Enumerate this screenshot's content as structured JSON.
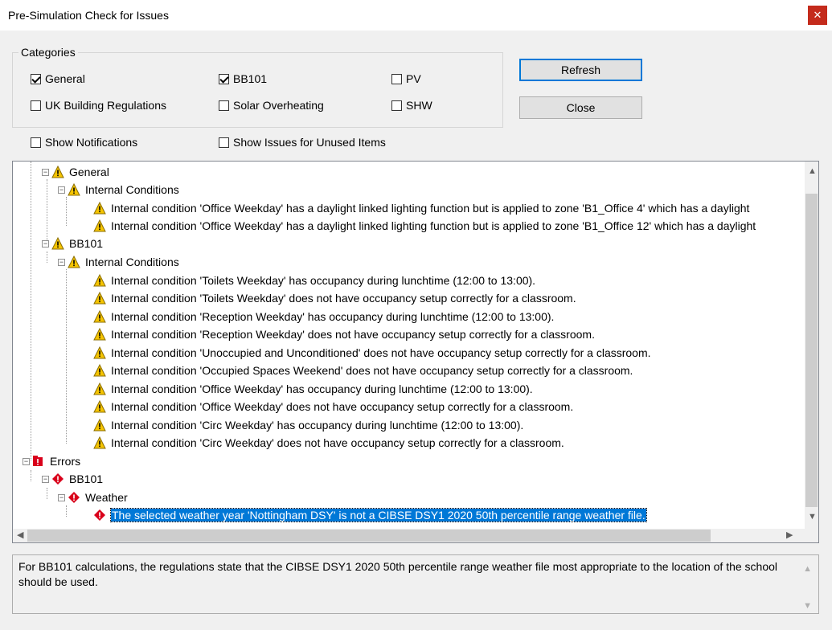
{
  "window": {
    "title": "Pre-Simulation Check for Issues",
    "close_glyph": "✕"
  },
  "categories": {
    "label": "Categories",
    "items": [
      {
        "label": "General",
        "checked": true
      },
      {
        "label": "BB101",
        "checked": true
      },
      {
        "label": "PV",
        "checked": false
      },
      {
        "label": "UK Building Regulations",
        "checked": false
      },
      {
        "label": "Solar Overheating",
        "checked": false
      },
      {
        "label": "SHW",
        "checked": false
      }
    ]
  },
  "options": {
    "show_notifications": {
      "label": "Show Notifications",
      "checked": false
    },
    "show_unused": {
      "label": "Show Issues for Unused Items",
      "checked": false
    }
  },
  "buttons": {
    "refresh": "Refresh",
    "close": "Close"
  },
  "tree": {
    "general": "General",
    "general_internal": "Internal Conditions",
    "general_items": [
      "Internal condition 'Office Weekday' has a daylight linked lighting function but is applied to zone 'B1_Office 4' which has a daylight",
      "Internal condition 'Office Weekday' has a daylight linked lighting function but is applied to zone 'B1_Office 12' which has a daylight"
    ],
    "bb101": "BB101",
    "bb101_internal": "Internal Conditions",
    "bb101_items": [
      "Internal condition 'Toilets Weekday' has occupancy during lunchtime (12:00 to 13:00).",
      "Internal condition 'Toilets Weekday' does not have occupancy setup correctly for a classroom.",
      "Internal condition 'Reception Weekday' has occupancy during lunchtime (12:00 to 13:00).",
      "Internal condition 'Reception Weekday' does not have occupancy setup correctly for a classroom.",
      "Internal condition 'Unoccupied and Unconditioned' does not have occupancy setup correctly for a classroom.",
      "Internal condition 'Occupied Spaces Weekend' does not have occupancy setup correctly for a classroom.",
      "Internal condition 'Office Weekday' has occupancy during lunchtime (12:00 to 13:00).",
      "Internal condition 'Office Weekday' does not have occupancy setup correctly for a classroom.",
      "Internal condition 'Circ Weekday' has occupancy during lunchtime (12:00 to 13:00).",
      "Internal condition 'Circ Weekday' does not have occupancy setup correctly for a classroom."
    ],
    "errors": "Errors",
    "errors_bb101": "BB101",
    "errors_weather": "Weather",
    "errors_weather_item": "The selected weather year 'Nottingham DSY' is not a CIBSE DSY1 2020 50th percentile range weather file."
  },
  "description": "For BB101 calculations, the regulations state that the CIBSE DSY1 2020 50th percentile range weather file most appropriate to the location of the school should be used.",
  "colors": {
    "accent": "#0078d7",
    "warning": "#f5c400",
    "error": "#d9001b",
    "close": "#c42b1c"
  },
  "icons": {
    "warning": "warning-icon",
    "error": "error-icon",
    "category": "category-warning-icon",
    "errors_folder": "errors-icon"
  }
}
